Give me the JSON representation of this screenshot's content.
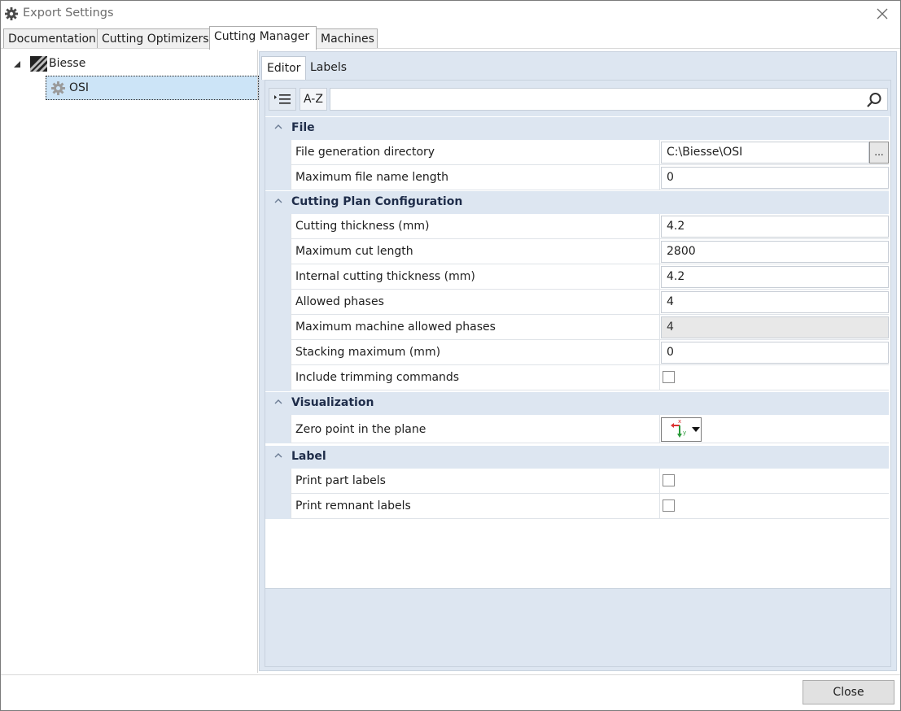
{
  "window": {
    "title": "Export Settings"
  },
  "tabs": [
    "Documentation",
    "Cutting Optimizers",
    "Cutting Manager",
    "Machines"
  ],
  "tree": {
    "root": "Biesse",
    "child": "OSI"
  },
  "inner_tabs": [
    "Editor",
    "Labels"
  ],
  "toolbar": {
    "az_label": "A-Z",
    "search_placeholder": ""
  },
  "categories": {
    "file": "File",
    "cutting": "Cutting Plan Configuration",
    "visualization": "Visualization",
    "label": "Label"
  },
  "properties": {
    "file_dir": {
      "name": "File generation directory",
      "value": "C:\\Biesse\\OSI"
    },
    "max_name_len": {
      "name": "Maximum file name length",
      "value": "0"
    },
    "cut_thickness": {
      "name": "Cutting thickness (mm)",
      "value": "4.2"
    },
    "max_cut_length": {
      "name": "Maximum cut length",
      "value": "2800"
    },
    "int_cut_thick": {
      "name": "Internal cutting thickness (mm)",
      "value": "4.2"
    },
    "allowed_phases": {
      "name": "Allowed phases",
      "value": "4"
    },
    "max_mach_phases": {
      "name": "Maximum machine allowed phases",
      "value": "4"
    },
    "stacking_max": {
      "name": "Stacking maximum (mm)",
      "value": "0"
    },
    "include_trim": {
      "name": "Include trimming commands"
    },
    "zero_point": {
      "name": "Zero point in the plane"
    },
    "print_part": {
      "name": "Print part labels"
    },
    "print_remnant": {
      "name": "Print remnant labels"
    }
  },
  "browse_label": "...",
  "close_label": "Close",
  "icons": {
    "title": "gear-icon",
    "tree_root": "biesse-logo-icon",
    "tree_child": "gear-icon",
    "search": "search-icon",
    "zero_point": "axis-origin-icon"
  },
  "colors": {
    "accent": "#dde6f1",
    "selection": "#cce4f7"
  }
}
